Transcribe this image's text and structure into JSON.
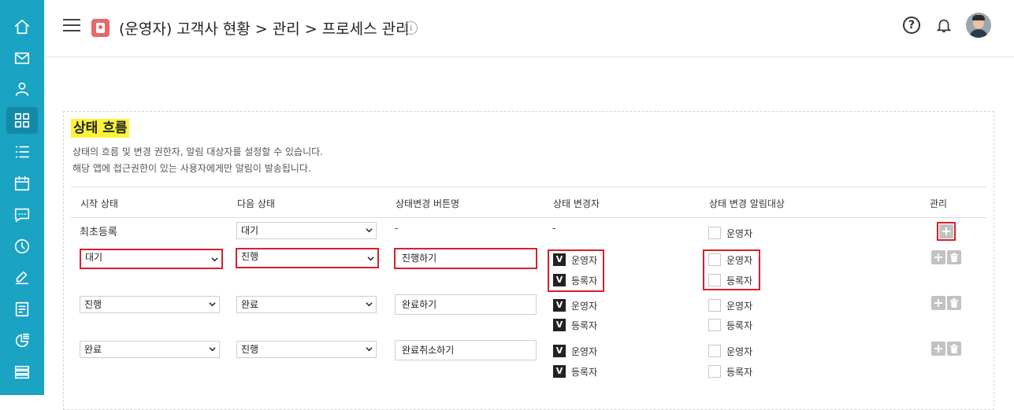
{
  "header": {
    "title": "(운영자) 고객사 현황 > 관리 > 프로세스 관리",
    "info_glyph": "i",
    "help_glyph": "?"
  },
  "sidebar": {
    "items": [
      {
        "icon": "home-icon"
      },
      {
        "icon": "mail-icon"
      },
      {
        "icon": "user-icon"
      },
      {
        "icon": "grid-icon",
        "active": true
      },
      {
        "icon": "list-icon"
      },
      {
        "icon": "calendar-icon"
      },
      {
        "icon": "chat-icon"
      },
      {
        "icon": "clock-icon"
      },
      {
        "icon": "edit-icon"
      },
      {
        "icon": "document-icon"
      },
      {
        "icon": "chart-icon"
      },
      {
        "icon": "stack-icon"
      }
    ]
  },
  "section": {
    "title": "상태 흐름",
    "desc1": "상태의 흐름 및 변경 권한자, 알림 대상자를 설정할 수 있습니다.",
    "desc2": "해당 앱에 접근권한이 있는 사용자에게만 알림이 발송됩니다."
  },
  "columns": {
    "start": "시작 상태",
    "next": "다음 상태",
    "button": "상태변경 버튼명",
    "changer": "상태 변경자",
    "notify": "상태 변경 알림대상",
    "manage": "관리"
  },
  "rows": {
    "r0": {
      "start_text": "최초등록",
      "next": "대기",
      "button_dash": "-",
      "changer_dash": "-",
      "notify": [
        {
          "label": "운영자",
          "checked": false
        }
      ]
    },
    "r1": {
      "start": "대기",
      "next": "진행",
      "button": "진행하기",
      "changer": [
        {
          "label": "운영자",
          "checked": true
        },
        {
          "label": "등록자",
          "checked": true
        }
      ],
      "notify": [
        {
          "label": "운영자",
          "checked": false
        },
        {
          "label": "등록자",
          "checked": false
        }
      ]
    },
    "r2": {
      "start": "진행",
      "next": "완료",
      "button": "완료하기",
      "changer": [
        {
          "label": "운영자",
          "checked": true
        },
        {
          "label": "등록자",
          "checked": true
        }
      ],
      "notify": [
        {
          "label": "운영자",
          "checked": false
        },
        {
          "label": "등록자",
          "checked": false
        }
      ]
    },
    "r3": {
      "start": "완료",
      "next": "진행",
      "button": "완료취소하기",
      "changer": [
        {
          "label": "운영자",
          "checked": true
        },
        {
          "label": "등록자",
          "checked": true
        }
      ],
      "notify": [
        {
          "label": "운영자",
          "checked": false
        },
        {
          "label": "등록자",
          "checked": false
        }
      ]
    }
  },
  "check_glyph": "V",
  "colors": {
    "sidebar": "#1aa3c2",
    "highlight_title": "#fbf43a",
    "alert_border": "#d8202a"
  }
}
